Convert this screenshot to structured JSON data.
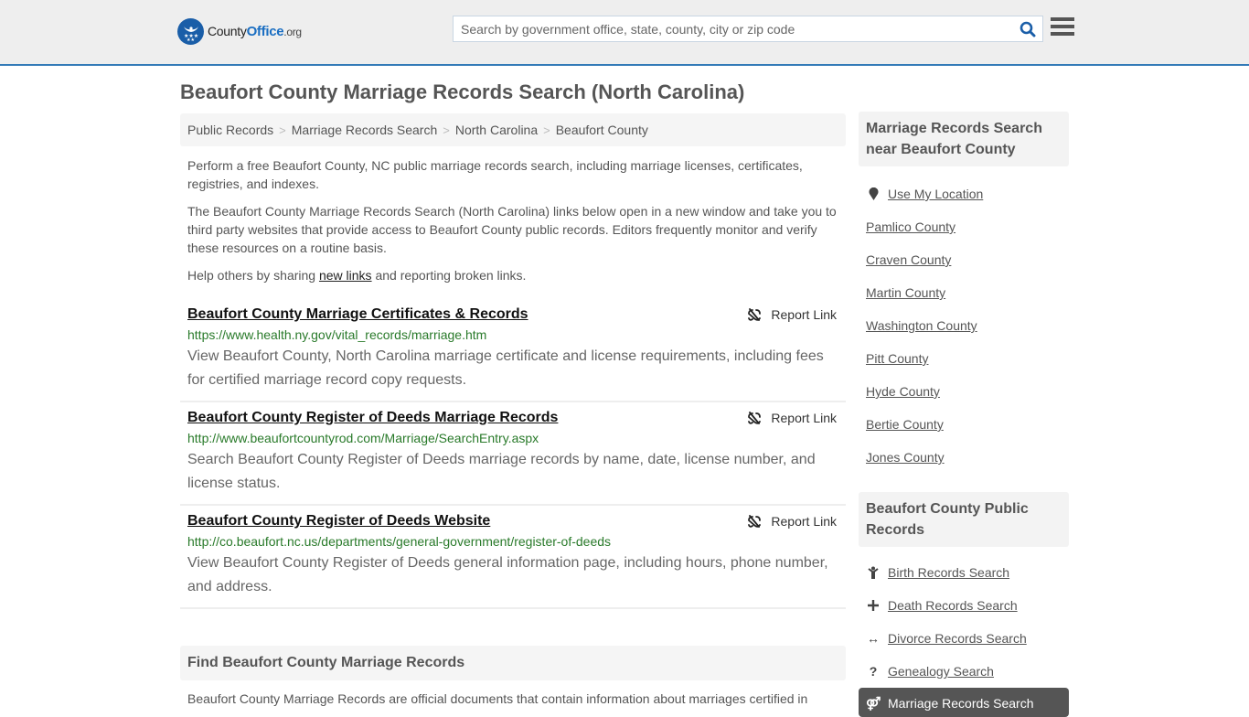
{
  "header": {
    "logo": {
      "county": "County",
      "office": "Office",
      "org": ".org"
    },
    "search_placeholder": "Search by government office, state, county, city or zip code",
    "search_value": ""
  },
  "page_title": "Beaufort County Marriage Records Search (North Carolina)",
  "breadcrumb": [
    {
      "label": "Public Records"
    },
    {
      "label": "Marriage Records Search"
    },
    {
      "label": "North Carolina"
    },
    {
      "label": "Beaufort County"
    }
  ],
  "intro": {
    "p1": "Perform a free Beaufort County, NC public marriage records search, including marriage licenses, certificates, registries, and indexes.",
    "p2": "The Beaufort County Marriage Records Search (North Carolina) links below open in a new window and take you to third party websites that provide access to Beaufort County public records. Editors frequently monitor and verify these resources on a routine basis.",
    "p3_before": "Help others by sharing ",
    "p3_link": "new links",
    "p3_after": " and reporting broken links."
  },
  "report_label": "Report Link",
  "results": [
    {
      "title": "Beaufort County Marriage Certificates & Records",
      "url": "https://www.health.ny.gov/vital_records/marriage.htm",
      "description": "View Beaufort County, North Carolina marriage certificate and license requirements, including fees for certified marriage record copy requests."
    },
    {
      "title": "Beaufort County Register of Deeds Marriage Records",
      "url": "http://www.beaufortcountyrod.com/Marriage/SearchEntry.aspx",
      "description": "Search Beaufort County Register of Deeds marriage records by name, date, license number, and license status."
    },
    {
      "title": "Beaufort County Register of Deeds Website",
      "url": "http://co.beaufort.nc.us/departments/general-government/register-of-deeds",
      "description": "View Beaufort County Register of Deeds general information page, including hours, phone number, and address."
    }
  ],
  "find_section": {
    "heading": "Find Beaufort County Marriage Records",
    "text": "Beaufort County Marriage Records are official documents that contain information about marriages certified in"
  },
  "sidebar": {
    "nearby_heading": "Marriage Records Search near Beaufort County",
    "use_location": "Use My Location",
    "nearby": [
      "Pamlico County",
      "Craven County",
      "Martin County",
      "Washington County",
      "Pitt County",
      "Hyde County",
      "Bertie County",
      "Jones County"
    ],
    "public_heading": "Beaufort County Public Records",
    "public_links": [
      {
        "label": "Birth Records Search",
        "icon": "child-icon"
      },
      {
        "label": "Death Records Search",
        "icon": "plus-icon"
      },
      {
        "label": "Divorce Records Search",
        "icon": "arrows-horizontal-icon"
      },
      {
        "label": "Genealogy Search",
        "icon": "question-icon"
      }
    ],
    "active_link": {
      "label": "Marriage Records Search",
      "icon": "marriage-rings-icon"
    }
  },
  "colors": {
    "brand_blue": "#1a5ea8",
    "header_border": "#337ab7",
    "url_green": "#297a2a",
    "active_bg": "#555555"
  }
}
